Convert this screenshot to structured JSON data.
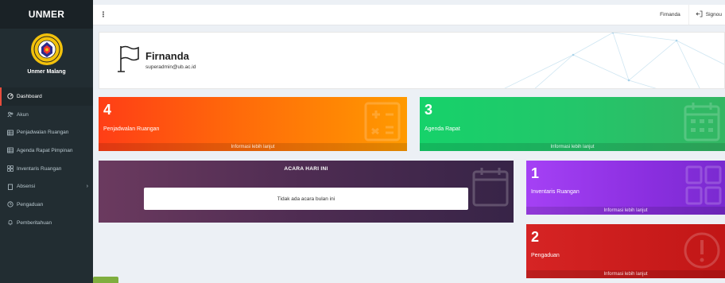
{
  "sidebar": {
    "brand": "UNMER",
    "org_name": "Unmer Malang",
    "items": [
      {
        "label": "Dashboard",
        "icon": "dashboard-icon"
      },
      {
        "label": "Akun",
        "icon": "users-icon"
      },
      {
        "label": "Penjadwalan Ruangan",
        "icon": "table-icon"
      },
      {
        "label": "Agenda Rapat Pimpinan",
        "icon": "table-icon"
      },
      {
        "label": "Inventaris Ruangan",
        "icon": "grid-icon"
      },
      {
        "label": "Absensi",
        "icon": "clipboard-icon"
      },
      {
        "label": "Pengaduan",
        "icon": "clock-icon"
      },
      {
        "label": "Pemberitahuan",
        "icon": "bell-icon"
      }
    ]
  },
  "topbar": {
    "menu_glyph": "⋮",
    "user": "Firnanda",
    "signout": "Signou"
  },
  "profile": {
    "name": "Firnanda",
    "email": "superadmin@ub.ac.id"
  },
  "stats": {
    "penjadwalan": {
      "count": "4",
      "label": "Penjadwalan Ruangan",
      "footer": "Informasi lebih lanjut"
    },
    "agenda": {
      "count": "3",
      "label": "Agenda Rapat",
      "footer": "Informasi lebih lanjut"
    },
    "inventaris": {
      "count": "1",
      "label": "Inventaris Ruangan",
      "footer": "Informasi lebih lanjut"
    },
    "pengaduan": {
      "count": "2",
      "label": "Pengaduan",
      "footer": "Informasi lebih lanjut"
    }
  },
  "acara": {
    "title": "ACARA HARI INI",
    "empty": "Tidak ada acara bulan ini"
  },
  "colors": {
    "sidebar_bg": "#222d32",
    "accent_active": "#e74c3c",
    "orange": "#ff6a0a",
    "green": "#23c66a",
    "purple": "#8b2fe0",
    "red": "#c11616"
  }
}
